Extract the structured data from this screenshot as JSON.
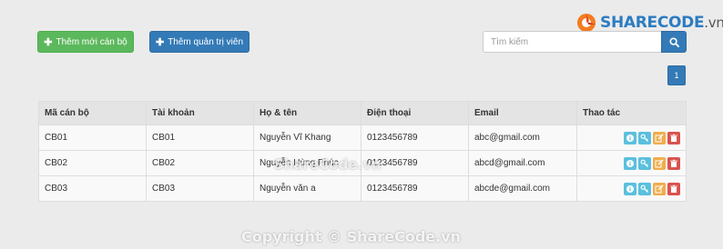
{
  "brand": {
    "name": "SHARECODE",
    "suffix": ".vn"
  },
  "toolbar": {
    "add_staff_label": "Thêm mới cán bộ",
    "add_admin_label": "Thêm quản trị viên"
  },
  "search": {
    "placeholder": "Tìm kiếm",
    "icon": "search-icon"
  },
  "pagination": {
    "current": "1"
  },
  "table": {
    "headers": [
      "Mã cán bộ",
      "Tài khoản",
      "Họ & tên",
      "Điện thoại",
      "Email",
      "Thao tác"
    ],
    "rows": [
      [
        "CB01",
        "CB01",
        "Nguyễn Vĩ Khang",
        "0123456789",
        "abc@gmail.com"
      ],
      [
        "CB02",
        "CB02",
        "Nguyễn Hùng Phúc",
        "0123456789",
        "abcd@gmail.com"
      ],
      [
        "CB03",
        "CB03",
        "Nguyễn văn a",
        "0123456789",
        "abcde@gmail.com"
      ]
    ],
    "actions": [
      "info-icon",
      "key-icon",
      "edit-icon",
      "delete-icon"
    ]
  },
  "colors": {
    "primary": "#337ab7",
    "success": "#5cb85c",
    "info": "#5bc0de",
    "warning": "#f0ad4e",
    "danger": "#d9534f"
  },
  "watermark": {
    "center": "ShareCode.vn",
    "bottom": "Copyright © ShareCode.vn"
  }
}
